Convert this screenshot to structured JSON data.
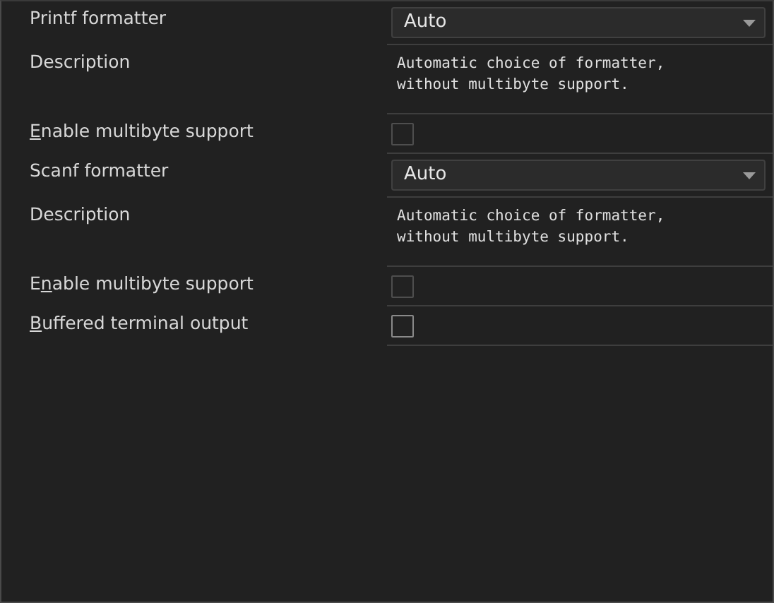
{
  "properties": [
    {
      "kind": "select",
      "label": "Printf formatter",
      "value": "Auto"
    },
    {
      "kind": "description",
      "label": "Description",
      "text": "Automatic choice of formatter,\nwithout multibyte support."
    },
    {
      "kind": "checkbox",
      "label_parts": [
        {
          "text": "E",
          "underlined": true
        },
        {
          "text": "nable multibyte support",
          "underlined": false
        }
      ],
      "checked": false,
      "disabled": true
    },
    {
      "kind": "select",
      "label": "Scanf formatter",
      "value": "Auto"
    },
    {
      "kind": "description",
      "label": "Description",
      "text": "Automatic choice of formatter,\nwithout multibyte support."
    },
    {
      "kind": "checkbox",
      "label_parts": [
        {
          "text": "E",
          "underlined": false
        },
        {
          "text": "n",
          "underlined": true
        },
        {
          "text": "able multibyte support",
          "underlined": false
        }
      ],
      "checked": false,
      "disabled": true
    },
    {
      "kind": "checkbox",
      "label_parts": [
        {
          "text": "B",
          "underlined": true
        },
        {
          "text": "uffered terminal output",
          "underlined": false
        }
      ],
      "checked": false,
      "disabled": false
    }
  ]
}
